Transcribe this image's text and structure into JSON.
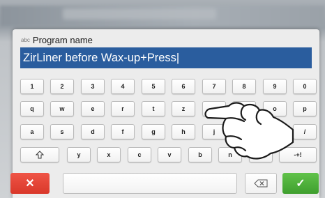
{
  "dialog": {
    "abc_icon": "abc",
    "title": "Program name",
    "input_value": "ZirLiner before Wax-up+Press|"
  },
  "keyboard": {
    "row1": [
      "1",
      "2",
      "3",
      "4",
      "5",
      "6",
      "7",
      "8",
      "9",
      "0"
    ],
    "row2": [
      "q",
      "w",
      "e",
      "r",
      "t",
      "z",
      "",
      "",
      "o",
      "p"
    ],
    "row3": [
      "a",
      "s",
      "d",
      "f",
      "g",
      "h",
      "j",
      "",
      "",
      "/"
    ],
    "row4": [
      "y",
      "x",
      "c",
      "v",
      "b",
      "n",
      "m",
      "-+!"
    ],
    "shift_icon": "shift-icon",
    "backspace_icon": "backspace-icon"
  },
  "actions": {
    "cancel_label": "✕",
    "confirm_label": "✓"
  },
  "colors": {
    "input_bg": "#2a5d9e",
    "cancel": "#e5473a",
    "confirm": "#52b13b"
  }
}
